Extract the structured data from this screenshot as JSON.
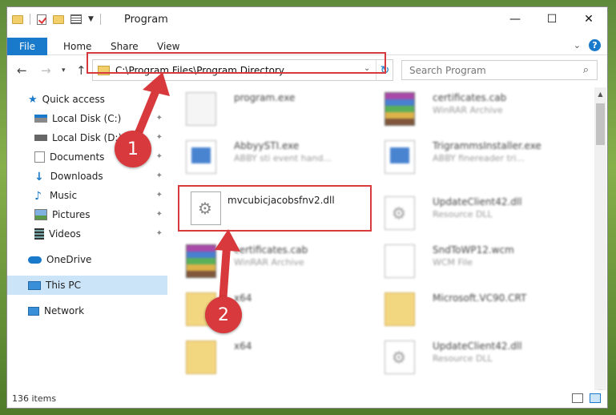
{
  "window": {
    "title": "Program"
  },
  "ribbon": {
    "tabs": [
      "File",
      "Home",
      "Share",
      "View"
    ]
  },
  "address": {
    "path": "C:\\Program Files\\Program Directory"
  },
  "search": {
    "placeholder": "Search Program"
  },
  "nav": {
    "quick_access": "Quick access",
    "items": [
      "Local Disk (C:)",
      "Local Disk (D:)",
      "Documents",
      "Downloads",
      "Music",
      "Pictures",
      "Videos"
    ],
    "onedrive": "OneDrive",
    "thispc": "This PC",
    "network": "Network"
  },
  "files": [
    {
      "name": "program.exe",
      "type": "",
      "icon": "exe-icon"
    },
    {
      "name": "certificates.cab",
      "type": "WinRAR Archive",
      "icon": "rar-icon"
    },
    {
      "name": "AbbyySTI.exe",
      "type": "ABBY sti event hand...",
      "icon": "exe-icon"
    },
    {
      "name": "TrigrammsInstaller.exe",
      "type": "ABBY finereader tri...",
      "icon": "exe-icon"
    },
    {
      "name": "mvcubicjacobsfnv2.dll",
      "type": "",
      "icon": "dll-gear-icon"
    },
    {
      "name": "UpdateClient42.dll",
      "type": "Resource DLL",
      "icon": "dll-gear-icon"
    },
    {
      "name": "certificates.cab",
      "type": "WinRAR Archive",
      "icon": "rar-icon"
    },
    {
      "name": "SndToWP12.wcm",
      "type": "WCM File",
      "icon": "file-icon"
    },
    {
      "name": "x64",
      "type": "",
      "icon": "folder-icon"
    },
    {
      "name": "Microsoft.VC90.CRT",
      "type": "",
      "icon": "folder-icon"
    },
    {
      "name": "x64",
      "type": "",
      "icon": "folder-icon"
    },
    {
      "name": "UpdateClient42.dll",
      "type": "Resource DLL",
      "icon": "dll-gear-icon"
    }
  ],
  "status": {
    "count": "136 items"
  },
  "callouts": [
    "1",
    "2"
  ],
  "colors": {
    "accent": "#1979ca",
    "highlight": "#d8393c"
  }
}
